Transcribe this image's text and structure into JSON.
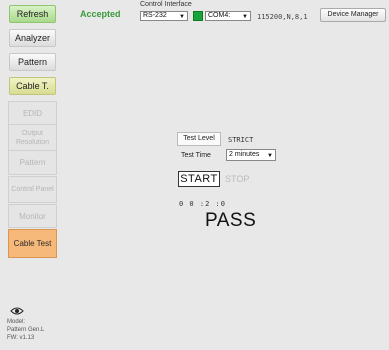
{
  "top_nav": {
    "refresh": "Refresh",
    "analyzer": "Analyzer",
    "pattern": "Pattern",
    "cable_test": "Cable T."
  },
  "status": {
    "accepted": "Accepted"
  },
  "control_interface": {
    "title": "Control Interface",
    "interface": "RS-232",
    "port": "COM4:",
    "baud": "115200,N,8,1",
    "device_manager": "Device Manager",
    "colors": {
      "port_ok": "#1aa33a"
    }
  },
  "sidebar": {
    "edid": "EDID",
    "output_resolution": "Output Resolution",
    "pattern": "Pattern",
    "control_panel": "Control Panel",
    "monitor": "Monitor",
    "cable_test": "Cable Test",
    "active_color": "#f7b97a"
  },
  "model": {
    "line1": "Model:",
    "line2": "Pattern Gen.L",
    "line3": "FW: v1.13"
  },
  "test": {
    "level_button": "Test Level",
    "level_value": "STRICT",
    "time_label": "Test Time",
    "time_value": "2 minutes",
    "start": "START",
    "stop": "STOP",
    "timer": "0  0 :2 :0",
    "result": "PASS"
  }
}
